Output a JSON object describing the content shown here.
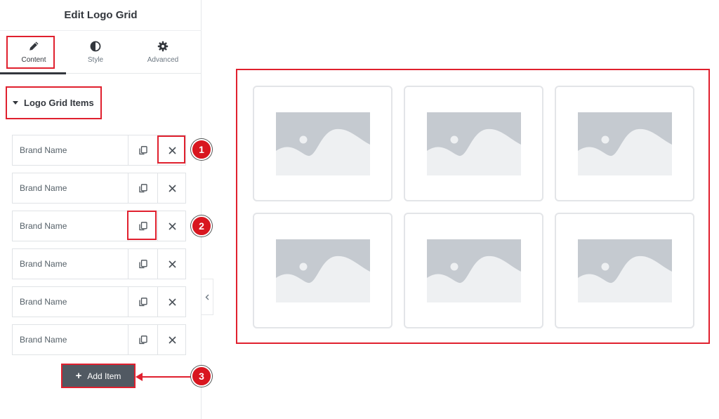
{
  "panel": {
    "title": "Edit Logo Grid",
    "tabs": [
      {
        "label": "Content",
        "icon": "pencil-icon",
        "active": true
      },
      {
        "label": "Style",
        "icon": "half-circle-icon",
        "active": false
      },
      {
        "label": "Advanced",
        "icon": "gear-icon",
        "active": false
      }
    ],
    "section_title": "Logo Grid Items",
    "items": [
      {
        "label": "Brand Name"
      },
      {
        "label": "Brand Name"
      },
      {
        "label": "Brand Name"
      },
      {
        "label": "Brand Name"
      },
      {
        "label": "Brand Name"
      },
      {
        "label": "Brand Name"
      }
    ],
    "add_item_label": "Add Item",
    "collapse_icon": "chevron-left-icon"
  },
  "markers": [
    "1",
    "2",
    "3"
  ],
  "preview": {
    "logo_count": 6,
    "placeholder_icon": "image-placeholder-icon"
  },
  "colors": {
    "highlight": "#e0202e",
    "marker": "#d8161f",
    "button": "#515962",
    "placeholder_bg": "#c5cad0",
    "placeholder_fg": "#eef0f2"
  }
}
